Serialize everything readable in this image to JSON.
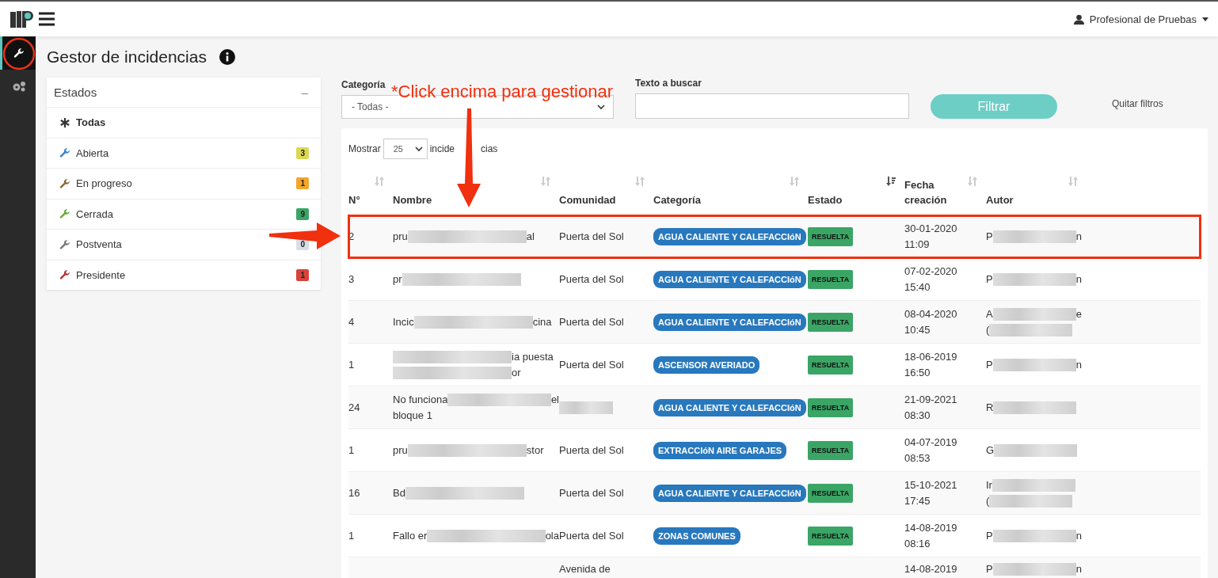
{
  "topbar": {
    "user": "Profesional de Pruebas"
  },
  "sidebar": {
    "items": [
      {
        "selected": true
      },
      {
        "selected": false
      }
    ]
  },
  "page": {
    "title": "Gestor de incidencias"
  },
  "estados": {
    "title": "Estados",
    "collapse": "–",
    "items": [
      {
        "kind": "all",
        "label": "Todas",
        "selected": true
      },
      {
        "kind": "status",
        "label": "Abierta",
        "count": "3",
        "color": "#dcd854",
        "selected": false
      },
      {
        "kind": "status",
        "label": "En progreso",
        "count": "1",
        "color": "#f4a62a",
        "selected": false
      },
      {
        "kind": "status",
        "label": "Cerrada",
        "count": "9",
        "color": "#3aa565",
        "selected": false
      },
      {
        "kind": "status",
        "label": "Postventa",
        "count": "0",
        "color": "#d8dde6",
        "selected": false
      },
      {
        "kind": "status",
        "label": "Presidente",
        "count": "1",
        "color": "#d9433a",
        "selected": false
      }
    ]
  },
  "filters": {
    "category_label": "Categoría",
    "category_value": "- Todas -",
    "search_label": "Texto a buscar",
    "filter_button": "Filtrar",
    "clear_link": "Quitar filtros"
  },
  "table": {
    "show_label": "Mostrar",
    "page_size": "25",
    "show_suffix_parts": [
      "incide",
      "cias"
    ],
    "columns": [
      {
        "label": "N°",
        "sorted": false
      },
      {
        "label": "Nombre",
        "sorted": false
      },
      {
        "label": "Comunidad",
        "sorted": false
      },
      {
        "label": "Categoría",
        "sorted": false
      },
      {
        "label": "Estado",
        "sorted": true
      },
      {
        "label": "Fecha creación",
        "sorted": false
      },
      {
        "label": "Autor",
        "sorted": false
      }
    ],
    "rows": [
      {
        "n": "2",
        "highlighted": true,
        "name": [
          [
            {
              "kind": "text",
              "text": "pru"
            },
            {
              "kind": "blur"
            },
            {
              "kind": "text",
              "text": "al"
            }
          ]
        ],
        "community": [
          [
            {
              "kind": "text",
              "text": "Puerta del Sol"
            }
          ]
        ],
        "category": "AGUA CALIENTE Y CALEFACCIóN",
        "status": "RESUELTA",
        "date": "30-01-2020",
        "time": "11:09",
        "author": [
          [
            {
              "kind": "text",
              "text": "P"
            },
            {
              "kind": "blur"
            },
            {
              "kind": "text",
              "text": "n"
            }
          ]
        ]
      },
      {
        "n": "3",
        "highlighted": false,
        "name": [
          [
            {
              "kind": "text",
              "text": "pr"
            },
            {
              "kind": "blur"
            }
          ]
        ],
        "community": [
          [
            {
              "kind": "text",
              "text": "Puerta del Sol"
            }
          ]
        ],
        "category": "AGUA CALIENTE Y CALEFACCIóN",
        "status": "RESUELTA",
        "date": "07-02-2020",
        "time": "15:40",
        "author": [
          [
            {
              "kind": "text",
              "text": "P"
            },
            {
              "kind": "blur"
            },
            {
              "kind": "text",
              "text": "n"
            }
          ]
        ]
      },
      {
        "n": "4",
        "highlighted": false,
        "name": [
          [
            {
              "kind": "text",
              "text": "Incic"
            },
            {
              "kind": "blur"
            },
            {
              "kind": "text",
              "text": "cina"
            }
          ]
        ],
        "community": [
          [
            {
              "kind": "text",
              "text": "Puerta del Sol"
            }
          ]
        ],
        "category": "AGUA CALIENTE Y CALEFACCIóN",
        "status": "RESUELTA",
        "date": "08-04-2020",
        "time": "10:45",
        "author": [
          [
            {
              "kind": "text",
              "text": "A"
            },
            {
              "kind": "blur"
            },
            {
              "kind": "text",
              "text": "e"
            }
          ],
          [
            {
              "kind": "text",
              "text": "("
            },
            {
              "kind": "blur"
            }
          ]
        ]
      },
      {
        "n": "1",
        "highlighted": false,
        "name": [
          [
            {
              "kind": "blur"
            },
            {
              "kind": "text",
              "text": "ia puesta"
            }
          ],
          [
            {
              "kind": "blur"
            },
            {
              "kind": "text",
              "text": "or"
            }
          ]
        ],
        "community": [
          [
            {
              "kind": "text",
              "text": "Puerta del Sol"
            }
          ]
        ],
        "category": "ASCENSOR AVERIADO",
        "status": "RESUELTA",
        "date": "18-06-2019",
        "time": "16:50",
        "author": [
          [
            {
              "kind": "text",
              "text": "P"
            },
            {
              "kind": "blur"
            },
            {
              "kind": "text",
              "text": "n"
            }
          ]
        ]
      },
      {
        "n": "24",
        "highlighted": false,
        "name": [
          [
            {
              "kind": "text",
              "text": "No funciona"
            },
            {
              "kind": "blur"
            },
            {
              "kind": "text",
              "text": "el"
            }
          ],
          [
            {
              "kind": "text",
              "text": "bloque 1"
            }
          ]
        ],
        "community": [
          [
            {
              "kind": "blur"
            }
          ]
        ],
        "category": "AGUA CALIENTE Y CALEFACCIóN",
        "status": "RESUELTA",
        "date": "21-09-2021",
        "time": "08:30",
        "author": [
          [
            {
              "kind": "text",
              "text": "R"
            },
            {
              "kind": "blur"
            }
          ]
        ]
      },
      {
        "n": "1",
        "highlighted": false,
        "name": [
          [
            {
              "kind": "text",
              "text": "pru"
            },
            {
              "kind": "blur"
            },
            {
              "kind": "text",
              "text": "stor"
            }
          ]
        ],
        "community": [
          [
            {
              "kind": "text",
              "text": "Puerta del Sol"
            }
          ]
        ],
        "category": "EXTRACCIóN AIRE GARAJES",
        "status": "RESUELTA",
        "date": "04-07-2019",
        "time": "08:53",
        "author": [
          [
            {
              "kind": "text",
              "text": "G"
            },
            {
              "kind": "blur"
            }
          ]
        ]
      },
      {
        "n": "16",
        "highlighted": false,
        "name": [
          [
            {
              "kind": "text",
              "text": "Bd"
            },
            {
              "kind": "blur"
            }
          ]
        ],
        "community": [
          [
            {
              "kind": "text",
              "text": "Puerta del Sol"
            }
          ]
        ],
        "category": "AGUA CALIENTE Y CALEFACCIóN",
        "status": "RESUELTA",
        "date": "15-10-2021",
        "time": "17:45",
        "author": [
          [
            {
              "kind": "text",
              "text": "Ir"
            },
            {
              "kind": "blur"
            }
          ],
          [
            {
              "kind": "text",
              "text": "("
            },
            {
              "kind": "blur"
            }
          ]
        ]
      },
      {
        "n": "1",
        "highlighted": false,
        "name": [
          [
            {
              "kind": "text",
              "text": "Fallo er"
            },
            {
              "kind": "blur"
            },
            {
              "kind": "text",
              "text": "ola"
            }
          ]
        ],
        "community": [
          [
            {
              "kind": "text",
              "text": "Puerta del Sol"
            }
          ]
        ],
        "category": "ZONAS COMUNES",
        "status": "RESUELTA",
        "date": "14-08-2019",
        "time": "08:16",
        "author": [
          [
            {
              "kind": "text",
              "text": "P"
            },
            {
              "kind": "blur"
            },
            {
              "kind": "text",
              "text": "n"
            }
          ]
        ]
      },
      {
        "highlighted": false,
        "name": [],
        "community": [
          [
            {
              "kind": "text",
              "text": "Avenida de"
            }
          ]
        ],
        "date": "14-08-2019",
        "author": [
          [
            {
              "kind": "text",
              "text": "P"
            },
            {
              "kind": "blur"
            },
            {
              "kind": "text",
              "text": "n"
            }
          ]
        ]
      }
    ]
  },
  "annotation": {
    "text": "*Click encima para gestionar"
  }
}
